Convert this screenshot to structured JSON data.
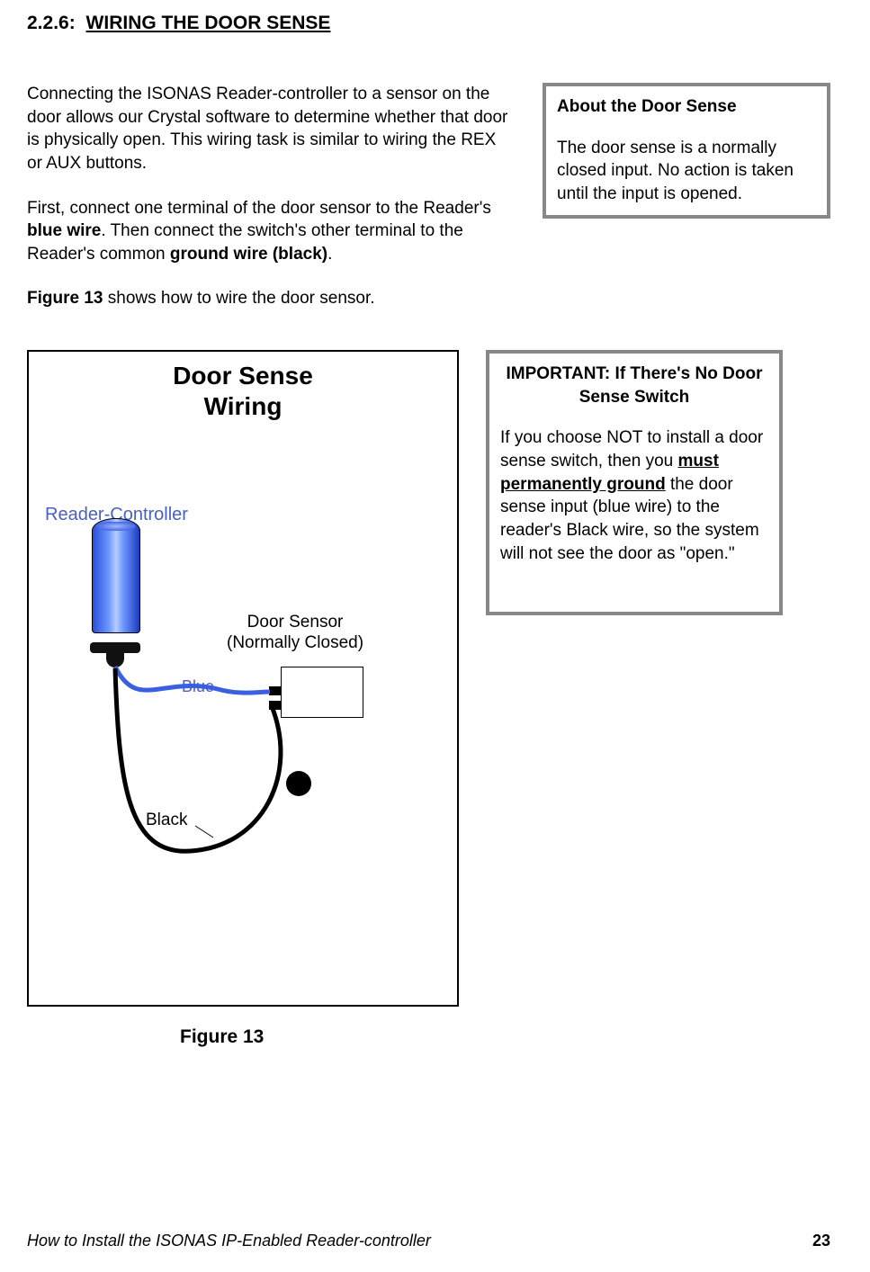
{
  "section": {
    "number": "2.2.6:",
    "title": "WIRING THE DOOR SENSE"
  },
  "body": {
    "p1": "Connecting the ISONAS Reader-controller to a sensor on the door allows our Crystal software to determine whether that door is physically open. This wiring task is similar to wiring the REX or AUX buttons.",
    "p2_a": "First, connect one terminal of the door sensor to the Reader's ",
    "p2_b": "blue wire",
    "p2_c": ". Then connect the switch's other terminal to the Reader's common ",
    "p2_d": "ground wire (black)",
    "p2_e": ".",
    "p3_a": "Figure 13",
    "p3_b": " shows how to wire the door sensor."
  },
  "callout1": {
    "title": "About the Door Sense",
    "text": "The door sense is a normally closed input. No action is taken until the input is opened."
  },
  "callout2": {
    "title": "IMPORTANT: If There's No Door Sense Switch",
    "t1": "If you choose NOT to install a door sense switch, then you ",
    "u": "must permanently ground",
    "t2": " the door sense input (blue wire) to the reader's Black wire, so the system will not see the door as \"open.\""
  },
  "figure": {
    "caption": "Figure 13",
    "title_l1": "Door Sense",
    "title_l2": "Wiring",
    "reader_label": "Reader-Controller",
    "sensor_label_l1": "Door Sensor",
    "sensor_label_l2": "(Normally Closed)",
    "wire_blue": "Blue",
    "wire_black": "Black"
  },
  "footer": {
    "left": "How to Install the ISONAS IP-Enabled Reader-controller",
    "page": "23"
  }
}
